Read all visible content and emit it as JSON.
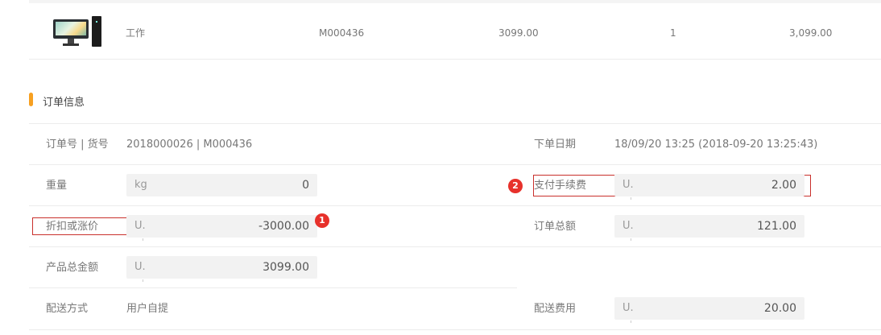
{
  "product_row": {
    "image_icon": "desktop-computer-icon",
    "name": "工作",
    "sku": "M000436",
    "price": "3099.00",
    "quantity": "1",
    "subtotal": "3,099.00"
  },
  "section": {
    "title": "订单信息",
    "accent_color": "#f7a021"
  },
  "order": {
    "order_no_label": "订单号 | 货号",
    "order_no_value": "2018000026 | M000436",
    "order_date_label": "下单日期",
    "order_date_value": "18/09/20 13:25 (2018-09-20 13:25:43)",
    "weight_label": "重量",
    "weight_prefix": "kg",
    "weight_value": "0",
    "fee_label": "支付手续费",
    "fee_prefix": "U.",
    "fee_value": "2.00",
    "discount_label": "折扣或涨价",
    "discount_prefix": "U.",
    "discount_value": "-3000.00",
    "total_label": "订单总额",
    "total_prefix": "U.",
    "total_value": "121.00",
    "product_total_label": "产品总金额",
    "product_total_prefix": "U.",
    "product_total_value": "3099.00",
    "shipping_method_label": "配送方式",
    "shipping_method_value": "用户自提",
    "shipping_fee_label": "配送费用",
    "shipping_fee_prefix": "U.",
    "shipping_fee_value": "20.00"
  },
  "annotations": {
    "badge_1": "1",
    "badge_2": "2",
    "highlight_color": "#c9302c"
  }
}
